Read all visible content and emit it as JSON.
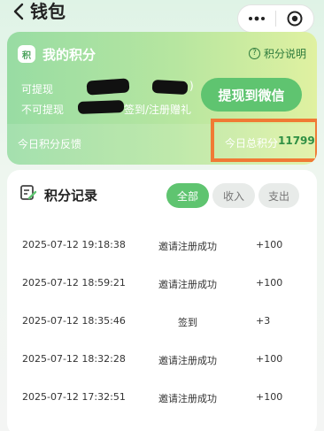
{
  "header": {
    "title": "钱包"
  },
  "points": {
    "title": "我的积分",
    "coin_label": "积",
    "rules_link": "积分说明",
    "withdrawable_label": "可提现",
    "withdrawable_suffix": ")",
    "frozen_label": "不可提现",
    "frozen_note": "签到/注册赠礼",
    "withdraw_button": "提现到微信",
    "feedback_label": "今日积分反馈",
    "total_label": "今日总积分",
    "total_value": "11799",
    "highlight_color": "#f07a35"
  },
  "records": {
    "title": "积分记录",
    "filters": [
      "全部",
      "收入",
      "支出"
    ],
    "selected_filter": "全部",
    "rows": [
      {
        "time": "2025-07-12 19:18:38",
        "type": "邀请注册成功",
        "amount": "+100"
      },
      {
        "time": "2025-07-12 18:59:21",
        "type": "邀请注册成功",
        "amount": "+100"
      },
      {
        "time": "2025-07-12 18:35:46",
        "type": "签到",
        "amount": "+3"
      },
      {
        "time": "2025-07-12 18:32:28",
        "type": "邀请注册成功",
        "amount": "+100"
      },
      {
        "time": "2025-07-12 17:32:51",
        "type": "邀请注册成功",
        "amount": "+100"
      }
    ]
  },
  "colors": {
    "accent": "#5fc470",
    "accent_dark": "#2f8f44"
  }
}
